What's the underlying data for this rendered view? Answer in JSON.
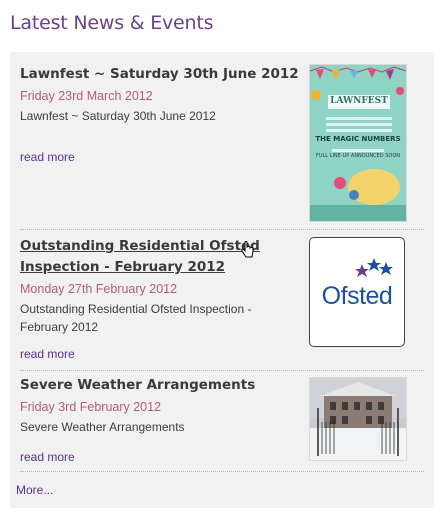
{
  "section": {
    "heading": "Latest News & Events",
    "more_label": "More..."
  },
  "news": [
    {
      "title": "Lawnfest ~ Saturday 30th June 2012",
      "date": "Friday 23rd March 2012",
      "summary": "Lawnfest ~ Saturday 30th June 2012",
      "read_more": "read more",
      "image": {
        "title": "LAWNFEST",
        "headline": "THE MAGIC NUMBERS",
        "subline": "FULL LINE-UP ANNOUNCED SOON"
      }
    },
    {
      "title": "Outstanding Residential Ofsted Inspection - February 2012",
      "date": "Monday 27th February 2012",
      "summary": "Outstanding Residential Ofsted Inspection - February 2012",
      "read_more": "read more",
      "image": {
        "logo_text": "Ofsted"
      }
    },
    {
      "title": "Severe Weather Arrangements",
      "date": "Friday 3rd February 2012",
      "summary": "Severe Weather Arrangements",
      "read_more": "read more",
      "image": {}
    }
  ],
  "colors": {
    "heading": "#6b3f8e",
    "date": "#b55a7d",
    "link": "#5b2f8c",
    "panel": "#f2f1f2",
    "poster_bg": "#8fd3c5",
    "ofsted_blue": "#1c4f9c"
  }
}
